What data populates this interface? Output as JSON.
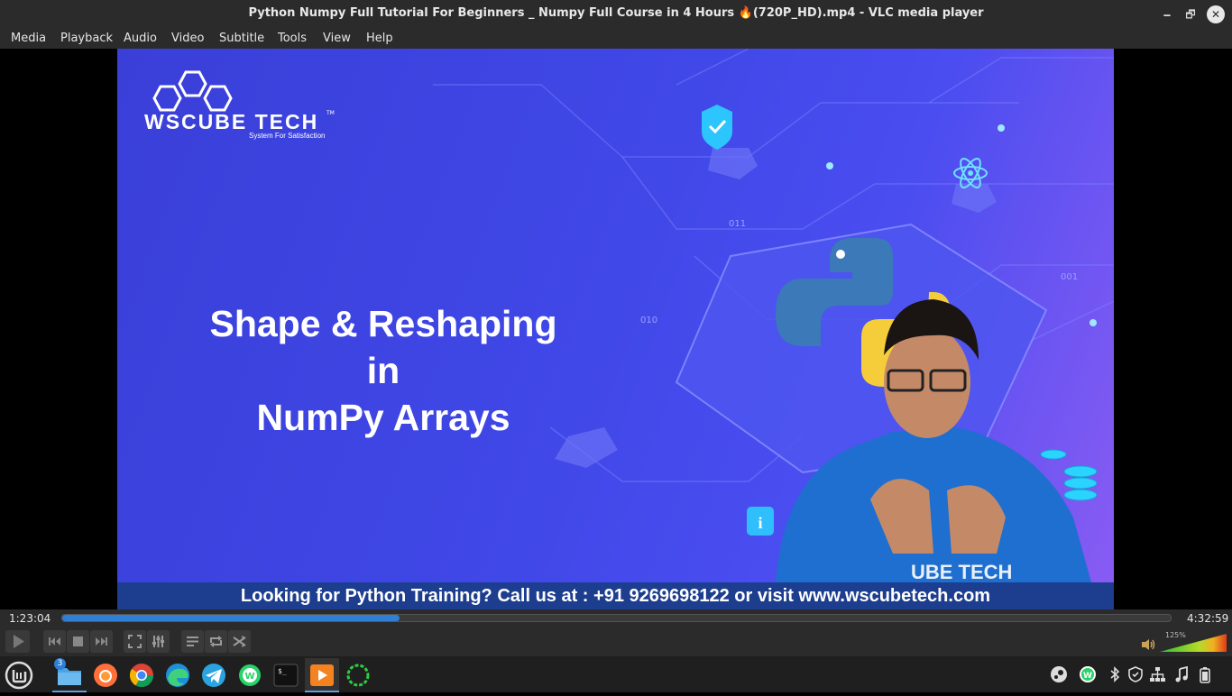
{
  "window": {
    "title": "Python Numpy Full Tutorial For Beginners _ Numpy Full Course in 4 Hours 🔥(720P_HD).mp4 - VLC media player",
    "minimize_glyph": "🗕",
    "maximize_glyph": "🗗",
    "close_glyph": "✕"
  },
  "menu": {
    "items": [
      "Media",
      "Playback",
      "Audio",
      "Video",
      "Subtitle",
      "Tools",
      "View",
      "Help"
    ]
  },
  "video": {
    "logo_text": "WSCUBE TECH",
    "logo_tm": "TM",
    "logo_tagline": "System For Satisfaction",
    "headline_lines": [
      "Shape &  Reshaping",
      "in",
      "NumPy Arrays"
    ],
    "banner": "Looking for Python Training? Call us at : +91 9269698122 or visit www.wscubetech.com",
    "deco_labels": [
      "011",
      "010",
      "001"
    ]
  },
  "seek": {
    "elapsed": "1:23:04",
    "total": "4:32:59",
    "progress_fraction": 0.304
  },
  "controls": {
    "volume_label": "125%",
    "volume_fraction": 1.0,
    "icons": [
      "play-icon",
      "previous-icon",
      "stop-icon",
      "next-icon",
      "fullscreen-icon",
      "extended-settings-icon",
      "playlist-icon",
      "loop-icon",
      "shuffle-icon",
      "speaker-icon"
    ]
  },
  "taskbar": {
    "files_badge": "3",
    "apps": [
      "menu-icon",
      "files-icon",
      "firefox-icon",
      "chrome-icon",
      "edge-icon",
      "telegram-icon",
      "whatsapp-icon",
      "terminal-icon",
      "vlc-icon",
      "spinner-icon"
    ],
    "tray": [
      "steam-icon",
      "whatsapp-tray-icon",
      "bluetooth-icon",
      "shield-icon",
      "network-icon",
      "music-icon",
      "battery-icon"
    ]
  },
  "colors": {
    "accent": "#2f7fd6",
    "chrome_bg": "#2b2b2b",
    "taskbar_bg": "#1f1f1f"
  }
}
